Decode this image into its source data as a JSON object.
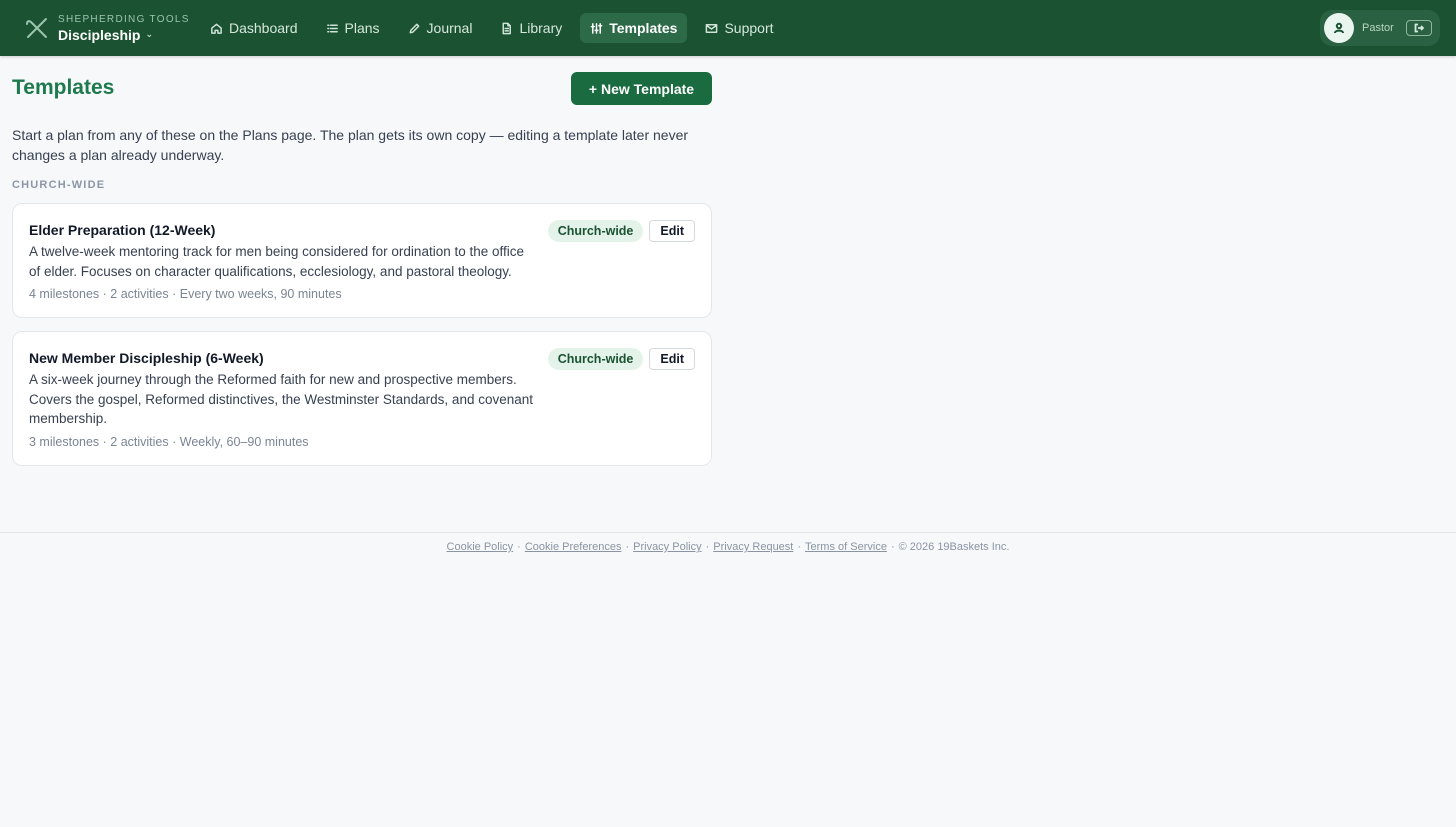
{
  "brand": {
    "kicker": "SHEPHERDING TOOLS",
    "name": "Discipleship",
    "logo_icon": "crossed-staffs-icon",
    "dropdown_icon": "chevron-down-icon"
  },
  "nav": [
    {
      "label": "Dashboard",
      "icon": "home-icon",
      "active": false
    },
    {
      "label": "Plans",
      "icon": "list-icon",
      "active": false
    },
    {
      "label": "Journal",
      "icon": "pencil-icon",
      "active": false
    },
    {
      "label": "Library",
      "icon": "document-icon",
      "active": false
    },
    {
      "label": "Templates",
      "icon": "sliders-icon",
      "active": true
    },
    {
      "label": "Support",
      "icon": "mail-icon",
      "active": false
    }
  ],
  "user": {
    "role": "Pastor",
    "avatar_icon": "user-icon",
    "logout_icon": "logout-icon"
  },
  "page": {
    "title": "Templates",
    "new_button": "+ New Template",
    "intro": "Start a plan from any of these on the Plans page. The plan gets its own copy — editing a template later never changes a plan already underway.",
    "section_label": "CHURCH-WIDE"
  },
  "templates": [
    {
      "title": "Elder Preparation (12-Week)",
      "description": "A twelve-week mentoring track for men being considered for ordination to the office of elder. Focuses on character qualifications, ecclesiology, and pastoral theology.",
      "meta": "4 milestones · 2 activities · Every two weeks, 90 minutes",
      "badge": "Church-wide",
      "edit": "Edit"
    },
    {
      "title": "New Member Discipleship (6-Week)",
      "description": "A six-week journey through the Reformed faith for new and prospective members. Covers the gospel, Reformed distinctives, the Westminster Standards, and covenant membership.",
      "meta": "3 milestones · 2 activities · Weekly, 60–90 minutes",
      "badge": "Church-wide",
      "edit": "Edit"
    }
  ],
  "footer": {
    "links": [
      "Cookie Policy",
      "Cookie Preferences",
      "Privacy Policy",
      "Privacy Request",
      "Terms of Service"
    ],
    "separator": "·",
    "copyright": "© 2026 19Baskets Inc."
  },
  "colors": {
    "header_bg": "#1a5232",
    "accent": "#1e7a4c",
    "primary_button": "#1a6b3f",
    "badge_bg": "#e4f3ea",
    "page_bg": "#f7f8fa"
  }
}
